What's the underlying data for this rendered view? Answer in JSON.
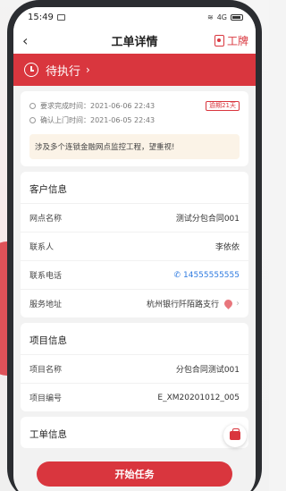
{
  "status_bar": {
    "time": "15:49",
    "network": "4G"
  },
  "header": {
    "title": "工单详情",
    "right_label": "工牌"
  },
  "banner": {
    "status": "待执行"
  },
  "times": {
    "required_label": "要求完成时间：",
    "required_value": "2021-06-06 22:43",
    "overdue": "逾期21天",
    "confirmed_label": "确认上门时间：",
    "confirmed_value": "2021-06-05 22:43"
  },
  "note": "涉及多个连锁金融网点监控工程，望重视!",
  "customer": {
    "title": "客户信息",
    "rows": [
      {
        "label": "网点名称",
        "value": "测试分包合同001"
      },
      {
        "label": "联系人",
        "value": "李依依"
      },
      {
        "label": "联系电话",
        "value": "14555555555"
      },
      {
        "label": "服务地址",
        "value": "杭州银行阡陌路支行"
      }
    ]
  },
  "project": {
    "title": "项目信息",
    "rows": [
      {
        "label": "项目名称",
        "value": "分包合同测试001"
      },
      {
        "label": "项目编号",
        "value": "E_XM20201012_005"
      }
    ]
  },
  "order_info": {
    "title": "工单信息"
  },
  "actions": {
    "start": "开始任务"
  },
  "colors": {
    "accent": "#d9363e",
    "link": "#2f7be0"
  }
}
